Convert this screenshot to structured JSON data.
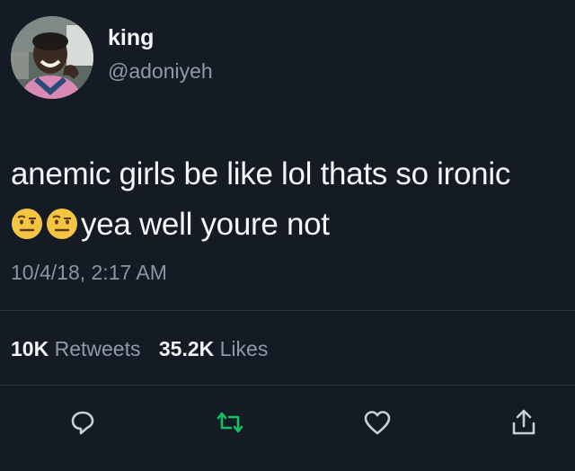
{
  "tweet": {
    "display_name": "king",
    "handle": "@adoniyeh",
    "text_line1": "anemic girls be like lol thats so ironic",
    "text_line2": "yea well youre not",
    "emoji_icon": "raised-eyebrow-face-icon",
    "timestamp": "10/4/18, 2:17 AM"
  },
  "stats": {
    "retweets_count": "10K",
    "retweets_label": "Retweets",
    "likes_count": "35.2K",
    "likes_label": "Likes"
  },
  "actions": [
    {
      "icon": "reply-icon"
    },
    {
      "icon": "retweet-icon"
    },
    {
      "icon": "like-heart-icon"
    },
    {
      "icon": "share-icon"
    }
  ],
  "colors": {
    "background": "#151b24",
    "text": "#f3f5f7",
    "secondary_text": "#8f9aa6",
    "retweet_accent": "#17bf63",
    "divider": "#2a323d"
  }
}
